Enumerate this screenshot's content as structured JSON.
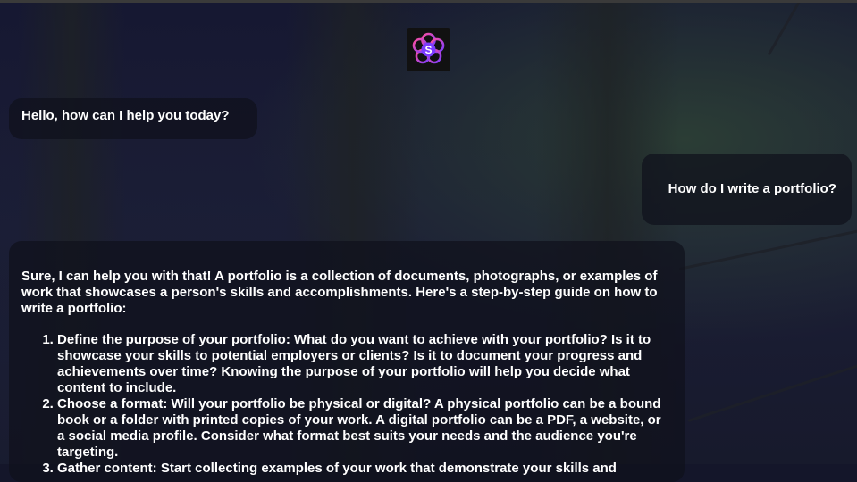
{
  "app": {
    "logo_letter": "S",
    "colors": {
      "accent": "#8a2be2",
      "logo_ring": "#ff4fa0"
    }
  },
  "messages": [
    {
      "role": "assistant",
      "text": "Hello, how can I help you today?"
    },
    {
      "role": "user",
      "text": "How do I write a portfolio?"
    },
    {
      "role": "assistant",
      "intro": "Sure, I can help you with that! A portfolio is a collection of documents, photographs, or examples of work that showcases a person's skills and accomplishments. Here's a step-by-step guide on how to write a portfolio:",
      "steps": [
        "Define the purpose of your portfolio: What do you want to achieve with your portfolio? Is it to showcase your skills to potential employers or clients? Is it to document your progress and achievements over time? Knowing the purpose of your portfolio will help you decide what content to include.",
        "Choose a format: Will your portfolio be physical or digital? A physical portfolio can be a bound book or a folder with printed copies of your work. A digital portfolio can be a PDF, a website, or a social media profile. Consider what format best suits your needs and the audience you're targeting.",
        "Gather content: Start collecting examples of your work that demonstrate your skills and"
      ]
    }
  ]
}
